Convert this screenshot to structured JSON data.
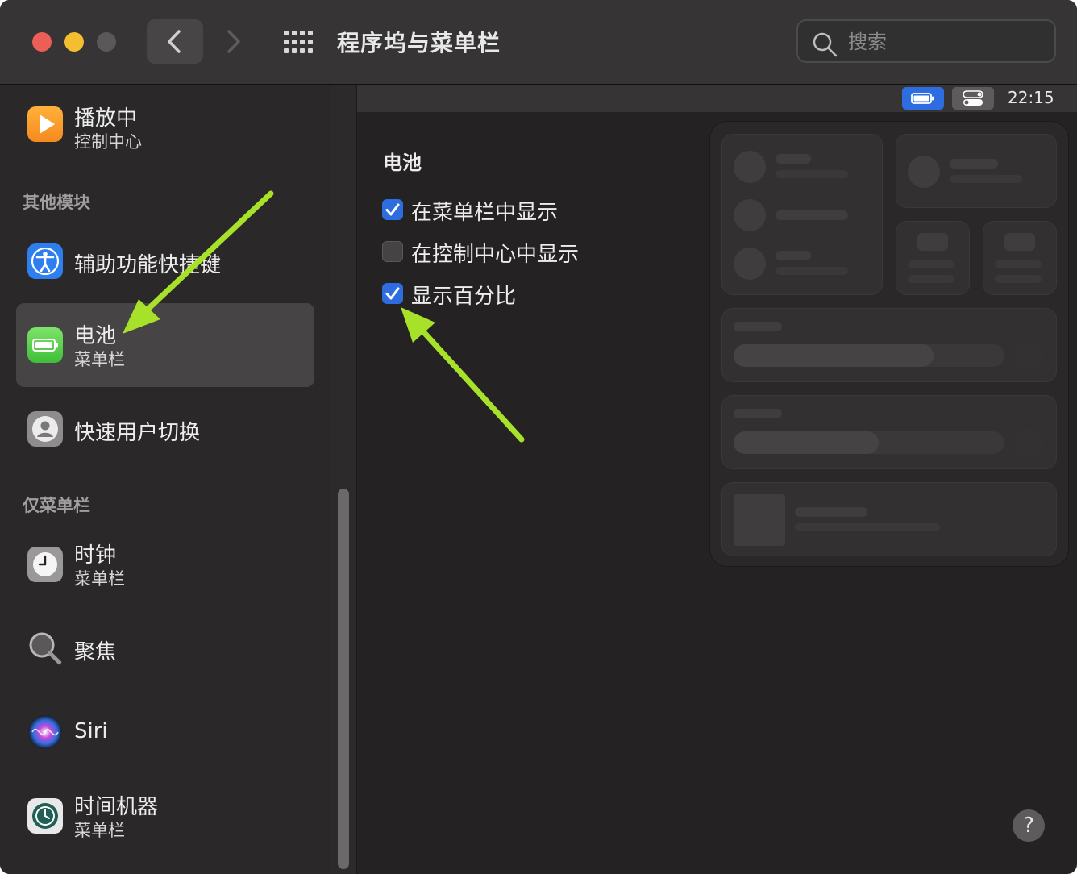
{
  "window": {
    "title": "程序坞与菜单栏",
    "search_placeholder": "搜索"
  },
  "sidebar": {
    "top_item": {
      "name": "播放中",
      "sub": "控制中心",
      "icon": "play-icon"
    },
    "sections": [
      {
        "title": "其他模块",
        "items": [
          {
            "name": "辅助功能快捷键",
            "icon": "accessibility-icon"
          },
          {
            "name": "电池",
            "sub": "菜单栏",
            "icon": "battery-icon",
            "selected": true
          },
          {
            "name": "快速用户切换",
            "icon": "user-switch-icon"
          }
        ]
      },
      {
        "title": "仅菜单栏",
        "items": [
          {
            "name": "时钟",
            "sub": "菜单栏",
            "icon": "clock-icon"
          },
          {
            "name": "聚焦",
            "icon": "spotlight-icon"
          },
          {
            "name": "Siri",
            "icon": "siri-icon"
          },
          {
            "name": "时间机器",
            "sub": "菜单栏",
            "icon": "time-machine-icon"
          }
        ]
      }
    ]
  },
  "menubar_preview": {
    "time": "22:15"
  },
  "main": {
    "title": "电池",
    "options": [
      {
        "label": "在菜单栏中显示",
        "checked": true
      },
      {
        "label": "在控制中心中显示",
        "checked": false
      },
      {
        "label": "显示百分比",
        "checked": true
      }
    ]
  },
  "help": {
    "label": "?"
  },
  "colors": {
    "accent": "#2d6de0",
    "annotation_arrow": "#a8e12a"
  }
}
